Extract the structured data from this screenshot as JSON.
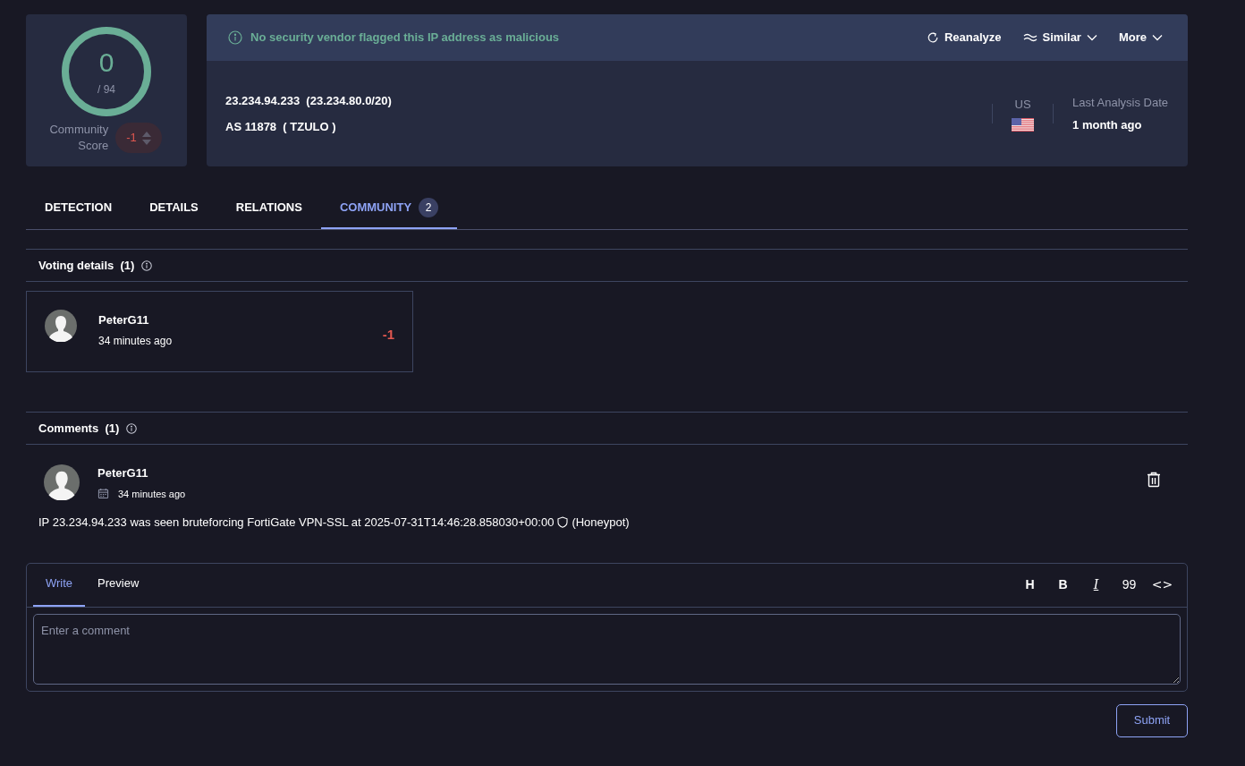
{
  "score": {
    "detections": "0",
    "total": "/ 94",
    "community_label": "Community Score",
    "community_value": "-1"
  },
  "banner": {
    "message": "No security vendor flagged this IP address as malicious",
    "actions": [
      {
        "label": "Reanalyze",
        "kind": "reload"
      },
      {
        "label": "Similar",
        "kind": "similar"
      },
      {
        "label": "More",
        "kind": "more"
      }
    ]
  },
  "summary": {
    "ip_line": "23.234.94.233  (23.234.80.0/20)",
    "as_line": "AS 11878  ( TZULO )",
    "country": "US",
    "last_analysis_label": "Last Analysis Date",
    "last_analysis_value": "1 month ago"
  },
  "tabs": [
    {
      "label": "DETECTION",
      "selected": false
    },
    {
      "label": "DETAILS",
      "selected": false
    },
    {
      "label": "RELATIONS",
      "selected": false
    },
    {
      "label": "COMMUNITY",
      "selected": true,
      "count": "2"
    }
  ],
  "voting": {
    "title": "Voting details",
    "count": "(1)",
    "votes": [
      {
        "user": "PeterG11",
        "time": "34 minutes ago",
        "value": "-1"
      }
    ]
  },
  "comments": {
    "title": "Comments",
    "count": "(1)",
    "items": [
      {
        "user": "PeterG11",
        "time": "34 minutes ago",
        "text_before": "IP 23.234.94.233 was seen bruteforcing FortiGate VPN-SSL at 2025-07-31T14:46:28.858030+00:00",
        "text_after": "(Honeypot)"
      }
    ]
  },
  "editor": {
    "tabs": [
      {
        "label": "Write",
        "selected": true
      },
      {
        "label": "Preview",
        "selected": false
      }
    ],
    "toolbar": [
      "H",
      "B",
      "I",
      "99",
      "<>"
    ],
    "placeholder": "Enter a comment",
    "submit": "Submit"
  }
}
